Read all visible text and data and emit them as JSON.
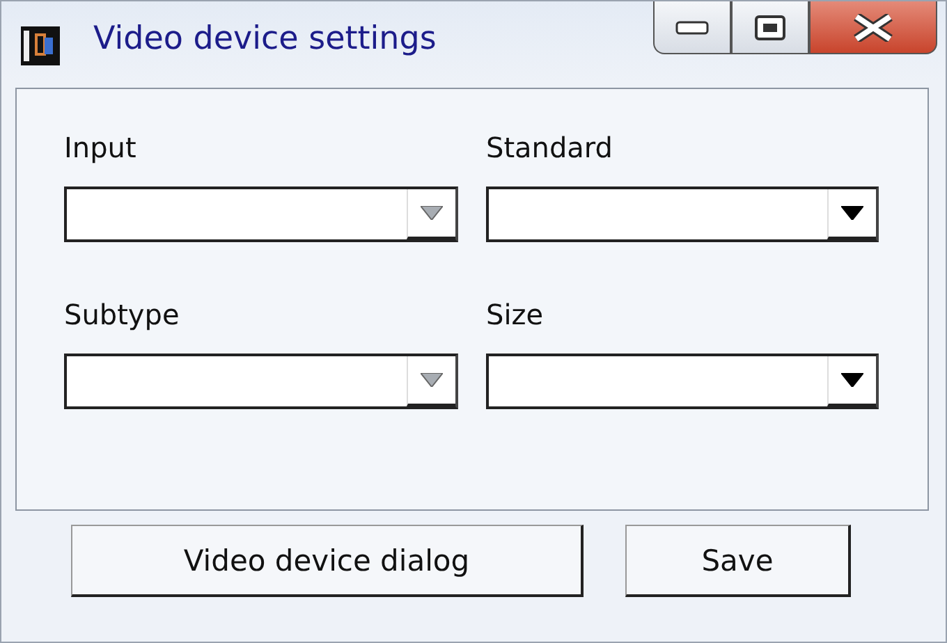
{
  "window": {
    "title": "Video device settings"
  },
  "fields": [
    {
      "label": "Input",
      "disabled": true
    },
    {
      "label": "Standard",
      "disabled": false
    },
    {
      "label": "Subtype",
      "disabled": true
    },
    {
      "label": "Size",
      "disabled": false
    }
  ],
  "buttons": [
    {
      "label": "Video device dialog"
    },
    {
      "label": "Save"
    }
  ]
}
